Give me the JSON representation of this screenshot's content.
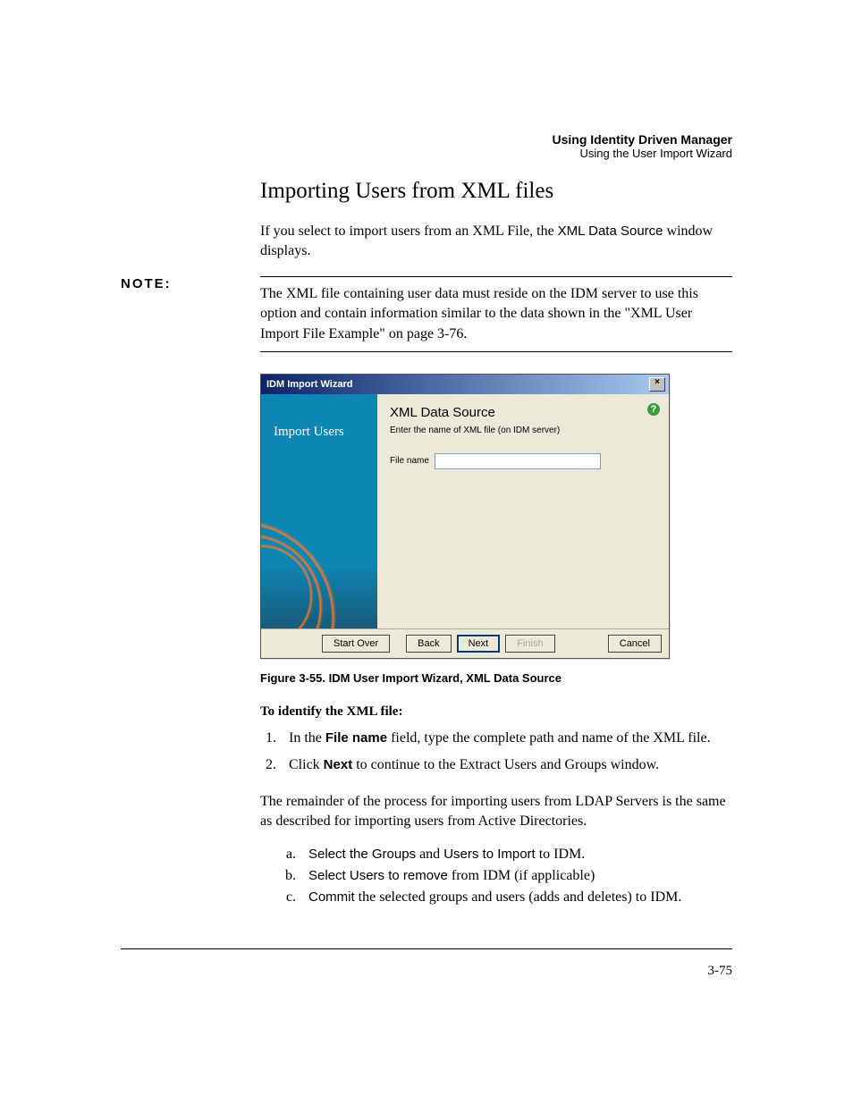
{
  "header": {
    "title": "Using Identity Driven Manager",
    "subtitle": "Using the User Import Wizard"
  },
  "section_heading": "Importing Users from XML files",
  "intro_p1_a": "If you select to import users from an XML File, the ",
  "intro_p1_b": "XML Data Source",
  "intro_p1_c": " window displays.",
  "note_label": "NOTE:",
  "note_text": "The XML file containing user data must reside on the IDM server to use this option and contain information similar to the data shown in the \"XML User Import File Example\" on page 3-76.",
  "wizard": {
    "title": "IDM Import Wizard",
    "side_title": "Import Users",
    "main_title": "XML Data Source",
    "main_desc": "Enter the name of XML file (on IDM server)",
    "field_label": "File name",
    "field_value": "",
    "buttons": {
      "start_over": "Start Over",
      "back": "Back",
      "next": "Next",
      "finish": "Finish",
      "cancel": "Cancel"
    }
  },
  "figure_caption": "Figure 3-55. IDM User Import Wizard, XML Data Source",
  "identify_heading": "To identify the XML file:",
  "step1_a": "In the ",
  "step1_b": "File name",
  "step1_c": " field, type the complete path and name of the XML file.",
  "step2_a": "Click ",
  "step2_b": "Next",
  "step2_c": " to continue to the Extract Users and Groups window.",
  "remainder_text": "The remainder of the process for importing users from LDAP Servers is the same as described for importing users from Active Directories.",
  "sub_a_1": "Select the Groups",
  "sub_a_2": " and ",
  "sub_a_3": "Users to Import",
  "sub_a_4": " to IDM.",
  "sub_b_1": "Select Users to remove",
  "sub_b_2": " from IDM (if applicable)",
  "sub_c_1": "Commit",
  "sub_c_2": " the selected groups and users (adds and deletes) to IDM.",
  "page_number": "3-75"
}
